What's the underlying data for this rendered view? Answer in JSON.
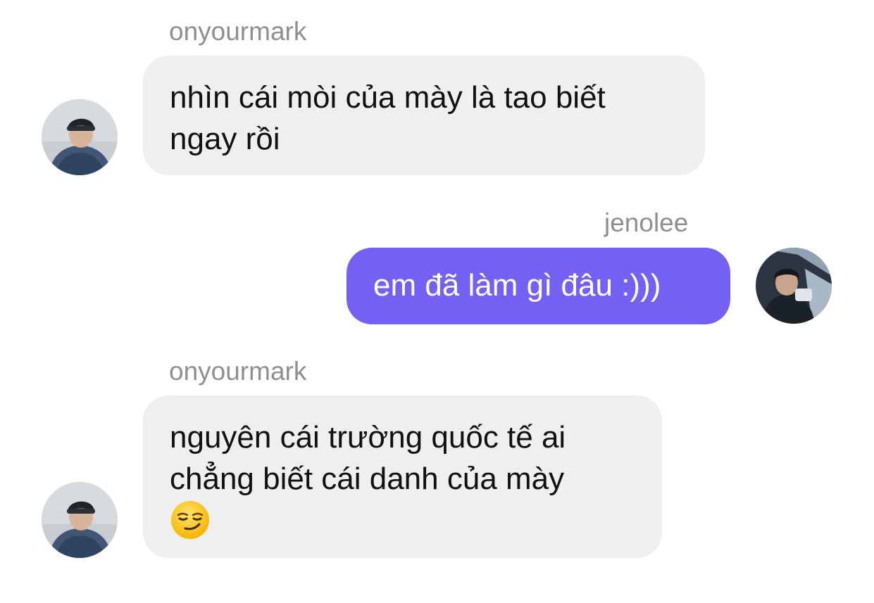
{
  "colors": {
    "incoming_bubble": "#efefef",
    "outgoing_bubble": "#7460f3",
    "sender_name": "#8e8e93",
    "background": "#ffffff"
  },
  "messages": [
    {
      "sender": "onyourmark",
      "direction": "incoming",
      "lines": [
        "nhìn cái mòi của mày là tao biết",
        "ngay rồi"
      ]
    },
    {
      "sender": "jenolee",
      "direction": "outgoing",
      "lines": [
        "em đã làm gì đâu :)))"
      ]
    },
    {
      "sender": "onyourmark",
      "direction": "incoming",
      "lines": [
        "nguyên cái trường quốc tế ai",
        "chẳng biết cái danh của mày"
      ],
      "emoji": "smirking-face-icon"
    }
  ]
}
